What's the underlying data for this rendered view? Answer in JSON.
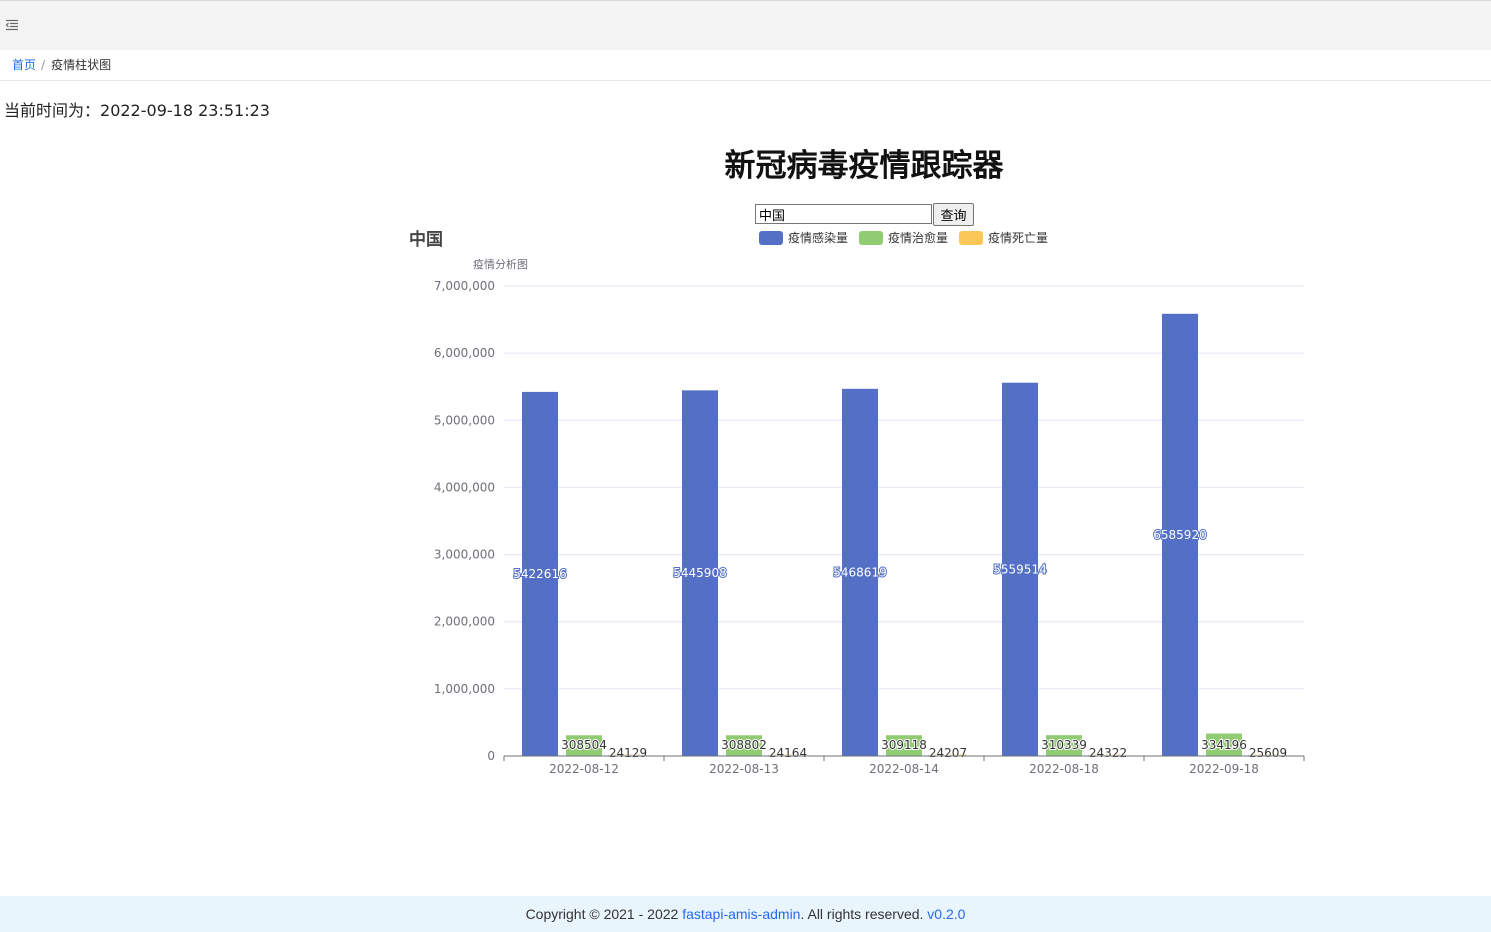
{
  "breadcrumb": {
    "home": "首页",
    "separator": "/",
    "current": "疫情柱状图"
  },
  "time": {
    "label": "当前时间为：",
    "value": "2022-09-18 23:51:23"
  },
  "page_title": "新冠病毒疫情跟踪器",
  "search": {
    "value": "中国",
    "button": "查询"
  },
  "footer": {
    "prefix": "Copyright © 2021 - 2022 ",
    "link": "fastapi-amis-admin",
    "middle": ". All rights reserved. ",
    "version": "v0.2.0"
  },
  "chart_data": {
    "type": "bar",
    "title": "中国",
    "subtitle": "疫情分析图",
    "categories": [
      "2022-08-12",
      "2022-08-13",
      "2022-08-14",
      "2022-08-18",
      "2022-09-18"
    ],
    "series": [
      {
        "name": "疫情感染量",
        "color": "#5470c6",
        "values": [
          5422616,
          5445908,
          5468619,
          5559514,
          6585920
        ]
      },
      {
        "name": "疫情治愈量",
        "color": "#91cc75",
        "values": [
          308504,
          308802,
          309118,
          310339,
          334196
        ]
      },
      {
        "name": "疫情死亡量",
        "color": "#fac858",
        "values": [
          24129,
          24164,
          24207,
          24322,
          25609
        ]
      }
    ],
    "ylim": [
      0,
      7000000
    ],
    "yticks": [
      0,
      1000000,
      2000000,
      3000000,
      4000000,
      5000000,
      6000000,
      7000000
    ],
    "grid": true,
    "legend": "top-center"
  }
}
